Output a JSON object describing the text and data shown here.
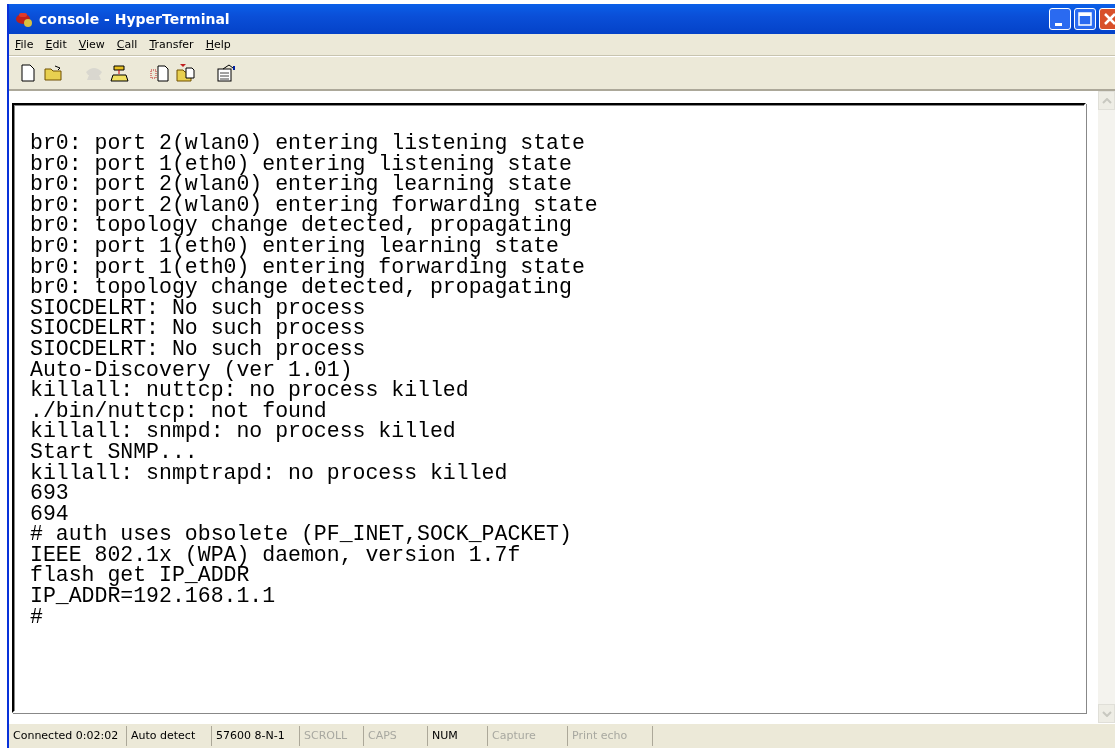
{
  "window": {
    "title": "console - HyperTerminal"
  },
  "menu": [
    {
      "access": "F",
      "rest": "ile"
    },
    {
      "access": "E",
      "rest": "dit"
    },
    {
      "access": "V",
      "rest": "iew"
    },
    {
      "access": "C",
      "rest": "all"
    },
    {
      "access": "T",
      "rest": "ransfer"
    },
    {
      "access": "H",
      "rest": "elp"
    }
  ],
  "toolbar": [
    {
      "kind": "new",
      "disabled": false
    },
    {
      "kind": "open",
      "disabled": false
    },
    {
      "kind": "disconnect",
      "disabled": true
    },
    {
      "kind": "call",
      "disabled": false
    },
    {
      "kind": "send",
      "disabled": false
    },
    {
      "kind": "receive",
      "disabled": false
    },
    {
      "kind": "properties",
      "disabled": false
    }
  ],
  "terminal": {
    "lines": [
      "br0: port 2(wlan0) entering listening state",
      "br0: port 1(eth0) entering listening state",
      "br0: port 2(wlan0) entering learning state",
      "br0: port 2(wlan0) entering forwarding state",
      "br0: topology change detected, propagating",
      "br0: port 1(eth0) entering learning state",
      "br0: port 1(eth0) entering forwarding state",
      "br0: topology change detected, propagating",
      "SIOCDELRT: No such process",
      "SIOCDELRT: No such process",
      "SIOCDELRT: No such process",
      "Auto-Discovery (ver 1.01)",
      "killall: nuttcp: no process killed",
      "./bin/nuttcp: not found",
      "killall: snmpd: no process killed",
      "Start SNMP...",
      "killall: snmptrapd: no process killed",
      "693",
      "694",
      "# auth uses obsolete (PF_INET,SOCK_PACKET)",
      "IEEE 802.1x (WPA) daemon, version 1.7f",
      "flash get IP_ADDR",
      "IP_ADDR=192.168.1.1",
      "#"
    ]
  },
  "status_bar": [
    {
      "kind": "field",
      "text": "Connected 0:02:02"
    },
    {
      "kind": "field",
      "text": "Auto detect"
    },
    {
      "kind": "field",
      "text": "57600 8-N-1"
    },
    {
      "kind": "indicator",
      "text": "SCROLL",
      "on": false
    },
    {
      "kind": "indicator",
      "text": "CAPS",
      "on": false
    },
    {
      "kind": "indicator",
      "text": "NUM",
      "on": true
    },
    {
      "kind": "indicator",
      "text": "Capture",
      "on": false
    },
    {
      "kind": "indicator",
      "text": "Print echo",
      "on": false
    }
  ]
}
